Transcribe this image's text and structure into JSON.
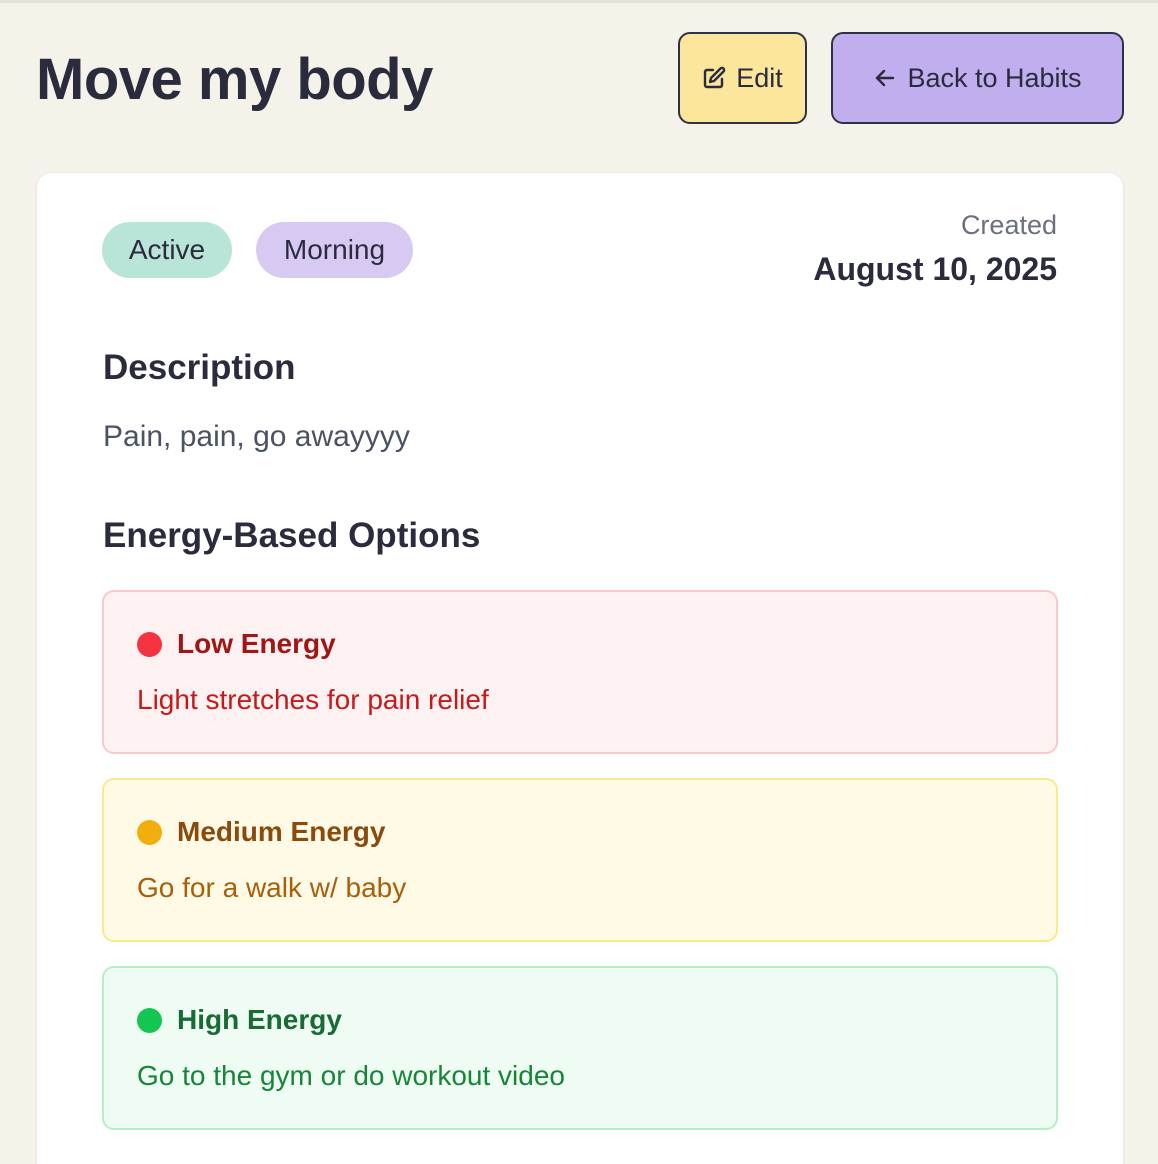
{
  "header": {
    "title": "Move my body",
    "edit_label": "Edit",
    "back_label": "Back to Habits"
  },
  "habit": {
    "badges": [
      "Active",
      "Morning"
    ],
    "created_label": "Created",
    "created_date": "August 10, 2025",
    "description_heading": "Description",
    "description": "Pain, pain, go awayyyy",
    "options_heading": "Energy-Based Options",
    "options": [
      {
        "level": "Low Energy",
        "text": "Light stretches for pain relief",
        "color": "#f5323f"
      },
      {
        "level": "Medium Energy",
        "text": "Go for a walk w/ baby",
        "color": "#f1ae0c"
      },
      {
        "level": "High Energy",
        "text": "Go to the gym or do workout video",
        "color": "#12c651"
      }
    ]
  },
  "icons": {
    "edit": "edit-icon",
    "back": "arrow-left-icon"
  },
  "colors": {
    "background": "#f5f2ea",
    "edit_button": "#fbe69c",
    "back_button": "#c1aeee",
    "badge_active": "#b9e4d8",
    "badge_morning": "#d8c9f3"
  }
}
